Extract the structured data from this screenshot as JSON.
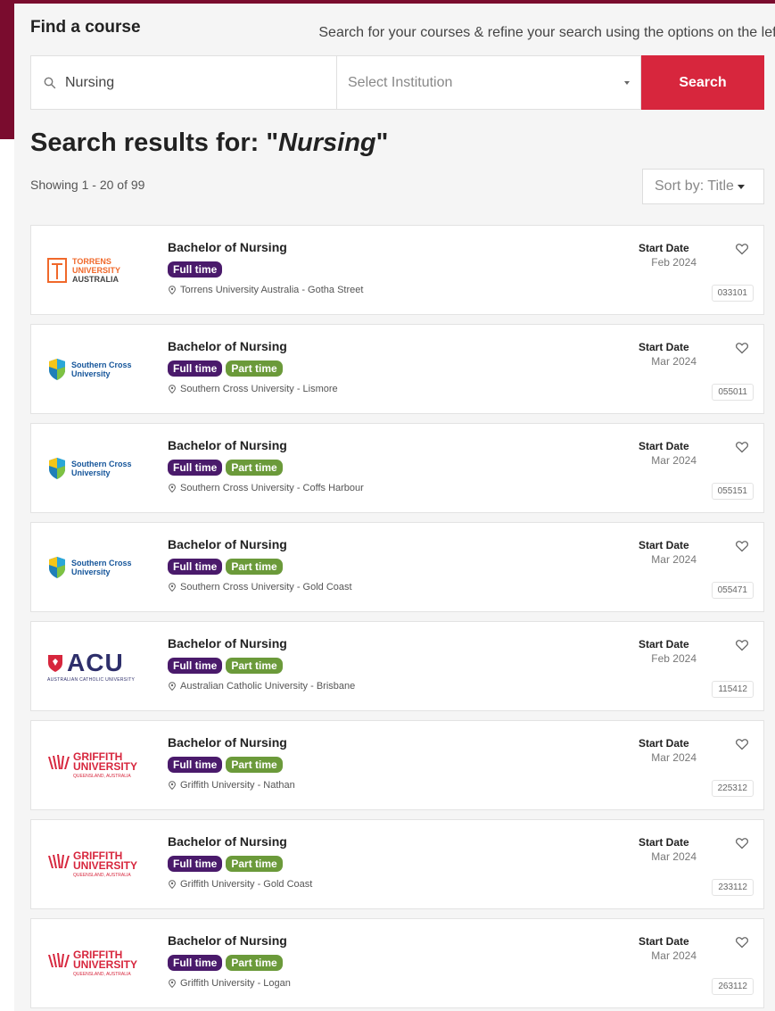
{
  "header": {
    "find_title": "Find a course",
    "hint": "Search for your courses & refine your search using the options on the left"
  },
  "search": {
    "value": "Nursing",
    "institution_placeholder": "Select Institution",
    "button_label": "Search"
  },
  "results": {
    "title_prefix": "Search results for: \"",
    "query": "Nursing",
    "title_suffix": "\"",
    "showing": "Showing 1 - 20 of 99",
    "sort_label": "Sort by: Title"
  },
  "labels": {
    "start_date": "Start Date",
    "full_time": "Full time",
    "part_time": "Part time"
  },
  "logos": {
    "torrens": [
      "TORRENS",
      "UNIVERSITY",
      "AUSTRALIA"
    ],
    "scu": [
      "Southern Cross",
      "University"
    ],
    "acu": [
      "ACU",
      "AUSTRALIAN CATHOLIC UNIVERSITY"
    ],
    "griffith": [
      "GRIFFITH",
      "UNIVERSITY",
      "QUEENSLAND, AUSTRALIA"
    ]
  },
  "courses": [
    {
      "title": "Bachelor of Nursing",
      "institution": "torrens",
      "campus": "Torrens University Australia - Gotha Street",
      "start": "Feb 2024",
      "code": "033101",
      "part_time": false
    },
    {
      "title": "Bachelor of Nursing",
      "institution": "scu",
      "campus": "Southern Cross University - Lismore",
      "start": "Mar 2024",
      "code": "055011",
      "part_time": true
    },
    {
      "title": "Bachelor of Nursing",
      "institution": "scu",
      "campus": "Southern Cross University - Coffs Harbour",
      "start": "Mar 2024",
      "code": "055151",
      "part_time": true
    },
    {
      "title": "Bachelor of Nursing",
      "institution": "scu",
      "campus": "Southern Cross University - Gold Coast",
      "start": "Mar 2024",
      "code": "055471",
      "part_time": true
    },
    {
      "title": "Bachelor of Nursing",
      "institution": "acu",
      "campus": "Australian Catholic University - Brisbane",
      "start": "Feb 2024",
      "code": "115412",
      "part_time": true
    },
    {
      "title": "Bachelor of Nursing",
      "institution": "griffith",
      "campus": "Griffith University - Nathan",
      "start": "Mar 2024",
      "code": "225312",
      "part_time": true
    },
    {
      "title": "Bachelor of Nursing",
      "institution": "griffith",
      "campus": "Griffith University - Gold Coast",
      "start": "Mar 2024",
      "code": "233112",
      "part_time": true
    },
    {
      "title": "Bachelor of Nursing",
      "institution": "griffith",
      "campus": "Griffith University - Logan",
      "start": "Mar 2024",
      "code": "263112",
      "part_time": true
    }
  ],
  "colors": {
    "accent": "#d7263d",
    "brand": "#7a0c2e",
    "full_time_badge": "#4a1a6b",
    "part_time_badge": "#6b9a3a"
  }
}
